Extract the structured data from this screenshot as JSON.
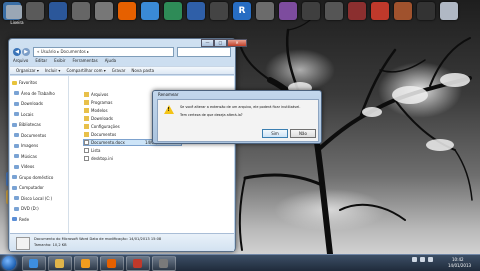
{
  "window": {
    "title": "",
    "address": "« Usuário ▸ Documentos ▸",
    "menu": [
      "Arquivo",
      "Editar",
      "Exibir",
      "Ferramentas",
      "Ajuda"
    ],
    "toolbar": [
      "Organizar ▾",
      "Incluir ▾",
      "Compartilhar com ▾",
      "Gravar",
      "Nova pasta"
    ],
    "sidebar": {
      "items": [
        {
          "label": "Favoritos",
          "icon": "star-icon"
        },
        {
          "label": "Área de Trabalho",
          "icon": "desktop-icon"
        },
        {
          "label": "Downloads",
          "icon": "downloads-icon"
        },
        {
          "label": "Locais",
          "icon": "folder-icon"
        },
        {
          "label": "Bibliotecas",
          "icon": "library-icon"
        },
        {
          "label": "Documentos",
          "icon": "documents-icon"
        },
        {
          "label": "Imagens",
          "icon": "pictures-icon"
        },
        {
          "label": "Músicas",
          "icon": "music-icon"
        },
        {
          "label": "Vídeos",
          "icon": "videos-icon"
        },
        {
          "label": "Grupo doméstico",
          "icon": "homegroup-icon"
        },
        {
          "label": "Computador",
          "icon": "computer-icon"
        },
        {
          "label": "Disco Local (C:)",
          "icon": "drive-icon"
        },
        {
          "label": "DVD (D:)",
          "icon": "dvd-icon"
        },
        {
          "label": "Rede",
          "icon": "network-icon"
        }
      ]
    },
    "files": [
      {
        "name": "Arquivos",
        "icon": "folder-icon"
      },
      {
        "name": "Programas",
        "icon": "folder-icon"
      },
      {
        "name": "Modelos",
        "icon": "folder-icon"
      },
      {
        "name": "Downloads",
        "icon": "folder-icon"
      },
      {
        "name": "Configurações",
        "icon": "folder-icon"
      },
      {
        "name": "Documentos",
        "icon": "folder-icon"
      },
      {
        "name": "Documento.docx",
        "icon": "document-icon",
        "date": "14/01/2013 15:08"
      },
      {
        "name": "Lista",
        "icon": "document-icon"
      },
      {
        "name": "desktop.ini",
        "icon": "document-icon"
      }
    ],
    "details": {
      "line1": "Documento do Microsoft Word    Data de modificação: 14/01/2013 15:08",
      "line2": "Tamanho: 10,2 KB"
    },
    "controls": {
      "minimize": "—",
      "maximize": "□",
      "close": "✕"
    }
  },
  "dialog": {
    "title": "Renomear",
    "line1": "Se você alterar a extensão de um arquivo, ele poderá ficar inutilizável.",
    "line2": "Tem certeza de que deseja alterá-la?",
    "yes": "Sim",
    "no": "Não"
  },
  "desktop_icons": [
    {
      "label": "Lixeira",
      "color": "#9aa7b5"
    },
    {
      "label": "",
      "color": "#4a7cc4"
    },
    {
      "label": "",
      "color": "#d4a84a"
    }
  ],
  "top_icons": [
    {
      "icon": "monitor-icon",
      "color": "#3a6ea5"
    },
    {
      "icon": "disc-icon",
      "color": "#5a5a5a"
    },
    {
      "icon": "word-icon",
      "color": "#2b579a"
    },
    {
      "icon": "pdf-icon",
      "color": "#666666"
    },
    {
      "icon": "document-icon",
      "color": "#777777"
    },
    {
      "icon": "firefox-icon",
      "color": "#e66000"
    },
    {
      "icon": "globe-icon",
      "color": "#3a8ad6"
    },
    {
      "icon": "table-icon",
      "color": "#2e8b57"
    },
    {
      "icon": "monitor-icon",
      "color": "#2f5fa8"
    },
    {
      "icon": "app-icon",
      "color": "#444444"
    },
    {
      "icon": "r-icon",
      "color": "#276dc3",
      "text": "R"
    },
    {
      "icon": "chart-icon",
      "color": "#6b6b6b"
    },
    {
      "icon": "grid-icon",
      "color": "#7d4c9e"
    },
    {
      "icon": "cube-icon",
      "color": "#3f3f3f"
    },
    {
      "icon": "app-icon",
      "color": "#555555"
    },
    {
      "icon": "balls-icon",
      "color": "#8b2f2f"
    },
    {
      "icon": "paint-icon",
      "color": "#c0392b"
    },
    {
      "icon": "bottle-icon",
      "color": "#a0522d"
    },
    {
      "icon": "text-icon",
      "color": "#333333"
    },
    {
      "icon": "trash-icon",
      "color": "#b0b8c4"
    }
  ],
  "taskbar": {
    "pinned": [
      {
        "icon": "ie-icon",
        "color": "#3d8ee0"
      },
      {
        "icon": "explorer-icon",
        "color": "#e0b44a"
      },
      {
        "icon": "media-icon",
        "color": "#f29c1f"
      },
      {
        "icon": "firefox-icon",
        "color": "#e66000"
      },
      {
        "icon": "paint-icon",
        "color": "#c0392b"
      },
      {
        "icon": "app-icon",
        "color": "#7a7a7a"
      }
    ],
    "clock_time": "10:42",
    "clock_date": "14/01/2013"
  }
}
